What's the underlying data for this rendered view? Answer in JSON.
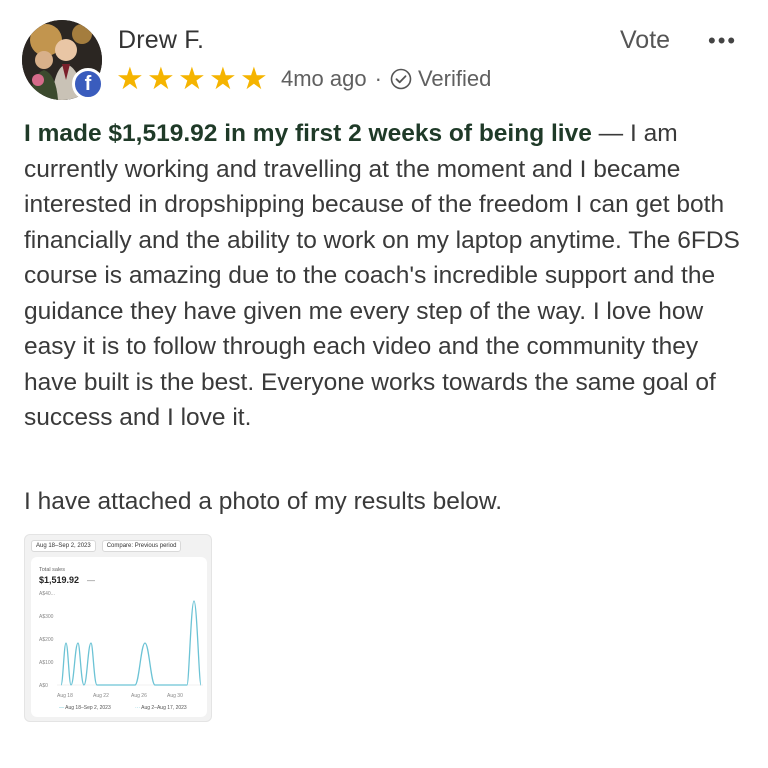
{
  "reviewer": {
    "name": "Drew F.",
    "rating": 5,
    "time_ago": "4mo ago",
    "separator": "·",
    "verified_label": "Verified"
  },
  "actions": {
    "vote_label": "Vote",
    "more_label": "•••"
  },
  "review": {
    "headline": "I made $1,519.92 in my first 2 weeks of being live",
    "body": " — I am currently working and travelling at the moment and I became interested in dropshipping because of the freedom I can get both financially and the ability to work on my laptop anytime. The 6FDS course is amazing due to the coach's incredible support and the guidance they have given me every step of the way. I love how easy it is to follow through each video and the community they have built is the best. Everyone works towards the same goal of success and I love it.",
    "attachment_note": "I have attached a photo of my results below."
  },
  "attachment": {
    "date_chip": "Aug 18–Sep 2, 2023",
    "compare_chip": "Compare: Previous period",
    "total_label": "Total sales",
    "total_value": "$1,519.92",
    "total_dash": "—",
    "legend_current": "Aug 18–Sep 2, 2023",
    "legend_previous": "Aug 2–Aug 17, 2023",
    "chart_data": {
      "type": "line",
      "x": [
        "Aug 18",
        "Aug 22",
        "Aug 26",
        "Aug 30"
      ],
      "y_ticks": [
        "A$0",
        "A$100",
        "A$200",
        "A$300",
        "A$40..."
      ],
      "ylim": [
        0,
        400
      ],
      "line_color": "#6cc3d5"
    }
  }
}
